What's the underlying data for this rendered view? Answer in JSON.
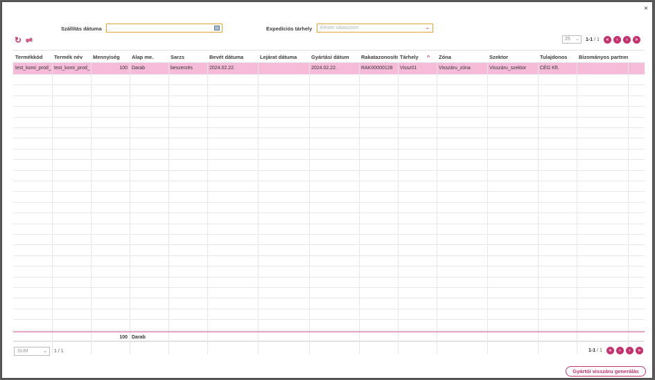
{
  "dialog": {
    "close_icon": "×"
  },
  "filters": {
    "shipping_date_label": "Szállítás dátuma",
    "shipping_date_value": "",
    "storage_label": "Expedíciós tárhely",
    "storage_placeholder": "Kérem válasszon!"
  },
  "toolbar": {
    "refresh_icon": "↻",
    "swap_icon": "⇌"
  },
  "pager": {
    "page_size": "25",
    "range": "1-1",
    "total": " / 1",
    "first": "«",
    "prev": "‹",
    "next": "›",
    "last": "»"
  },
  "table": {
    "columns": [
      "Termékkód",
      "Termék név",
      "Mennyiség",
      "Alap me.",
      "Sarzs",
      "Bevét dátuma",
      "Lejárat dátuma",
      "Gyártási dátum",
      "Rakatazonosító",
      "Tárhely",
      "Zóna",
      "Szektor",
      "Tulajdonos",
      "Bizományos partner"
    ],
    "sort_icon": "^",
    "rows": [
      [
        "test_komi_prod_",
        "test_komi_prod_",
        "100",
        "Darab",
        "beszerzés",
        "2024.02.22.",
        "",
        "2024.02.22.",
        "RAK00000128",
        "Vissz01",
        "Visszáru_zóna",
        "Visszáru_szektor",
        "CÉG Kft.",
        ""
      ]
    ],
    "sum": {
      "quantity": "100",
      "unit": "Darab"
    }
  },
  "footer": {
    "sum_select": "SUM",
    "sum_page": "1   /   1",
    "generate_button": "Gyártói visszáru generálás"
  },
  "colors": {
    "accent": "#c6326d",
    "selected_row": "#f5bbd9",
    "input_border": "#e9a22c"
  }
}
